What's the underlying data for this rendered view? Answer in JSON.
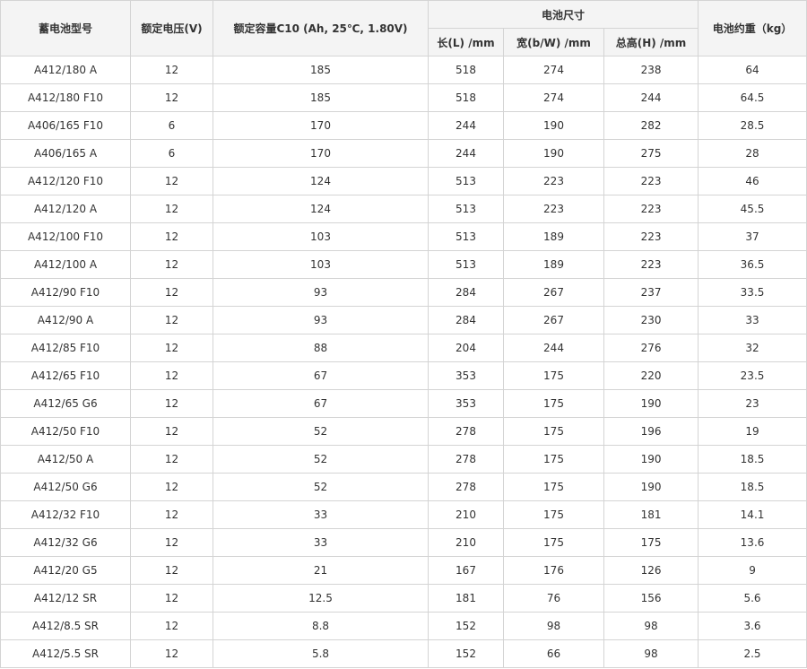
{
  "table": {
    "headers": {
      "model": "蓄电池型号",
      "voltage": "额定电压(V)",
      "capacity": "额定容量C10 (Ah, 25℃, 1.80V)",
      "dimensions": "电池尺寸",
      "length": "长(L) /mm",
      "width": "宽(b/W) /mm",
      "height": "总高(H) /mm",
      "weight": "电池约重（kg）"
    },
    "rows": [
      [
        "A412/180 A",
        "12",
        "185",
        "518",
        "274",
        "238",
        "64"
      ],
      [
        "A412/180 F10",
        "12",
        "185",
        "518",
        "274",
        "244",
        "64.5"
      ],
      [
        "A406/165 F10",
        "6",
        "170",
        "244",
        "190",
        "282",
        "28.5"
      ],
      [
        "A406/165 A",
        "6",
        "170",
        "244",
        "190",
        "275",
        "28"
      ],
      [
        "A412/120 F10",
        "12",
        "124",
        "513",
        "223",
        "223",
        "46"
      ],
      [
        "A412/120 A",
        "12",
        "124",
        "513",
        "223",
        "223",
        "45.5"
      ],
      [
        "A412/100 F10",
        "12",
        "103",
        "513",
        "189",
        "223",
        "37"
      ],
      [
        "A412/100 A",
        "12",
        "103",
        "513",
        "189",
        "223",
        "36.5"
      ],
      [
        "A412/90 F10",
        "12",
        "93",
        "284",
        "267",
        "237",
        "33.5"
      ],
      [
        "A412/90 A",
        "12",
        "93",
        "284",
        "267",
        "230",
        "33"
      ],
      [
        "A412/85 F10",
        "12",
        "88",
        "204",
        "244",
        "276",
        "32"
      ],
      [
        "A412/65 F10",
        "12",
        "67",
        "353",
        "175",
        "220",
        "23.5"
      ],
      [
        "A412/65 G6",
        "12",
        "67",
        "353",
        "175",
        "190",
        "23"
      ],
      [
        "A412/50 F10",
        "12",
        "52",
        "278",
        "175",
        "196",
        "19"
      ],
      [
        "A412/50 A",
        "12",
        "52",
        "278",
        "175",
        "190",
        "18.5"
      ],
      [
        "A412/50 G6",
        "12",
        "52",
        "278",
        "175",
        "190",
        "18.5"
      ],
      [
        "A412/32 F10",
        "12",
        "33",
        "210",
        "175",
        "181",
        "14.1"
      ],
      [
        "A412/32 G6",
        "12",
        "33",
        "210",
        "175",
        "175",
        "13.6"
      ],
      [
        "A412/20 G5",
        "12",
        "21",
        "167",
        "176",
        "126",
        "9"
      ],
      [
        "A412/12 SR",
        "12",
        "12.5",
        "181",
        "76",
        "156",
        "5.6"
      ],
      [
        "A412/8.5 SR",
        "12",
        "8.8",
        "152",
        "98",
        "98",
        "3.6"
      ],
      [
        "A412/5.5 SR",
        "12",
        "5.8",
        "152",
        "66",
        "98",
        "2.5"
      ]
    ]
  }
}
